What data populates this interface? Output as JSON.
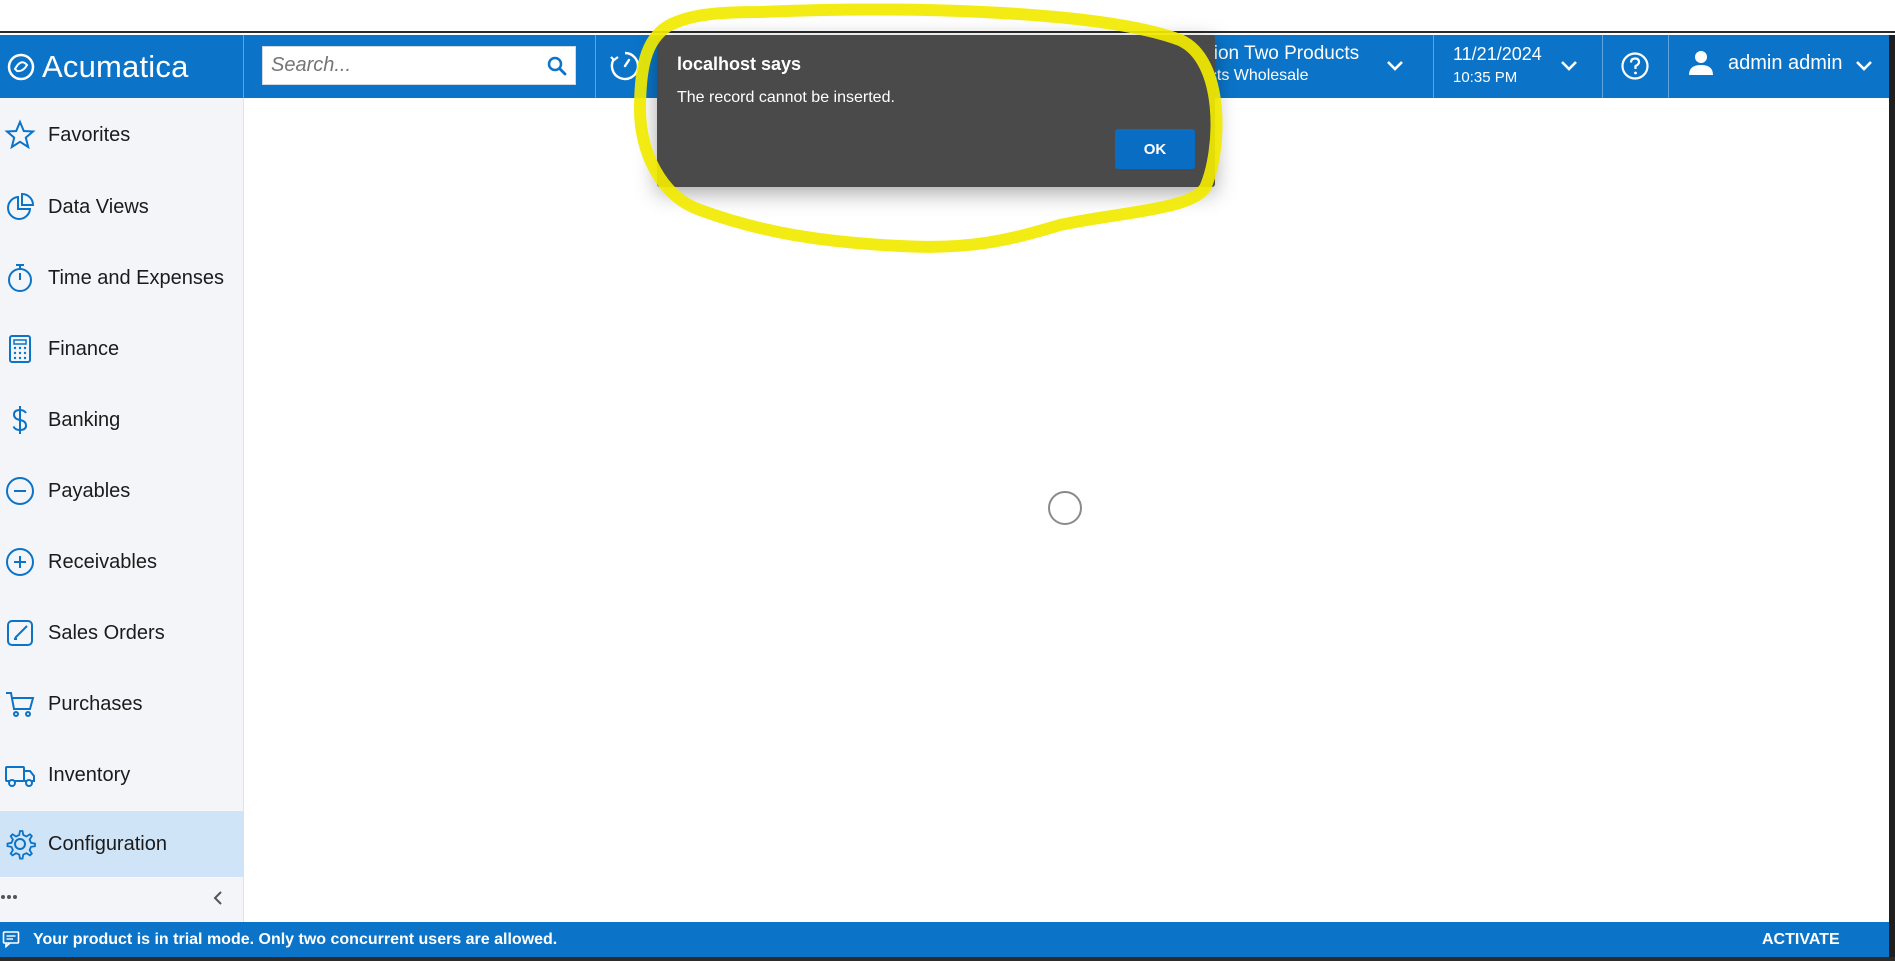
{
  "app": {
    "logo_text": "Acumatica"
  },
  "header": {
    "search_placeholder": "Search...",
    "branch_line1": "ision Two Products",
    "branch_line2": "ucts Wholesale",
    "date": "11/21/2024",
    "time": "10:35 PM",
    "user": "admin admin"
  },
  "sidebar": {
    "items": [
      {
        "label": "Favorites",
        "icon": "star-icon"
      },
      {
        "label": "Data Views",
        "icon": "pie-chart-icon"
      },
      {
        "label": "Time and Expenses",
        "icon": "stopwatch-icon"
      },
      {
        "label": "Finance",
        "icon": "calculator-icon"
      },
      {
        "label": "Banking",
        "icon": "dollar-icon"
      },
      {
        "label": "Payables",
        "icon": "minus-circle-icon"
      },
      {
        "label": "Receivables",
        "icon": "plus-circle-icon"
      },
      {
        "label": "Sales Orders",
        "icon": "edit-icon"
      },
      {
        "label": "Purchases",
        "icon": "cart-icon"
      },
      {
        "label": "Inventory",
        "icon": "truck-icon"
      },
      {
        "label": "Configuration",
        "icon": "gear-icon"
      }
    ],
    "active": "Configuration"
  },
  "dialog": {
    "title": "localhost says",
    "message": "The record cannot be inserted.",
    "ok_label": "OK"
  },
  "statusbar": {
    "message": "Your product is in trial mode. Only two concurrent users are allowed.",
    "activate_label": "ACTIVATE"
  },
  "colors": {
    "header_bg": "#0b74c8",
    "sidebar_bg": "#f3f5f8",
    "active_item_bg": "#cfe4f6",
    "icon_color": "#0b74c8",
    "dialog_bg": "#4a4a4a",
    "annotation_highlight": "#f2ea00"
  }
}
